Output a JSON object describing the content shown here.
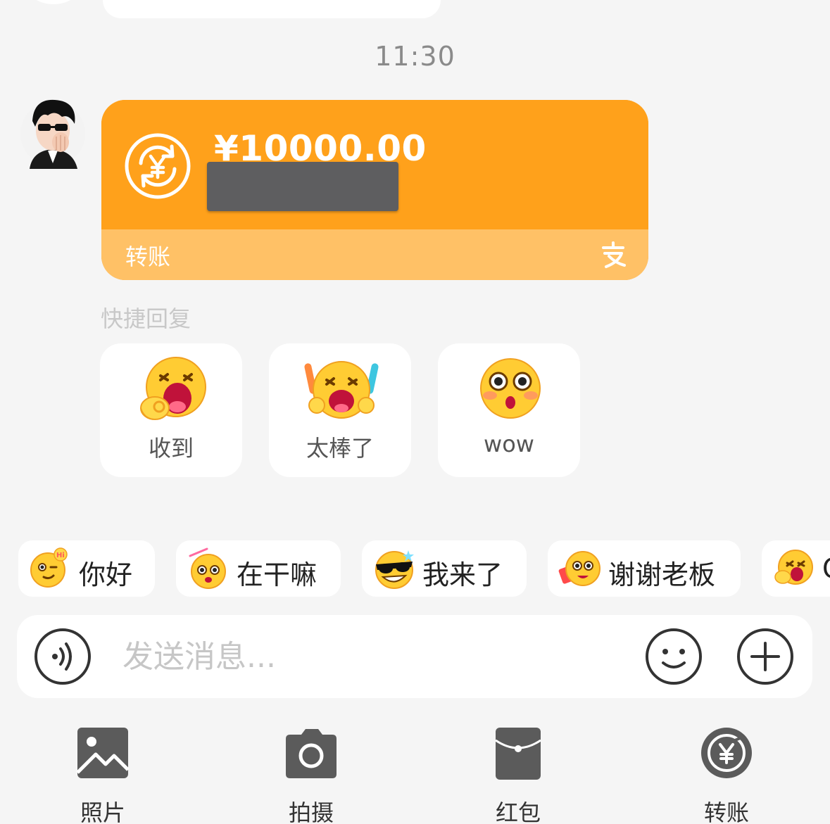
{
  "chat": {
    "timestamp": "11:30"
  },
  "transfer": {
    "amount": "¥10000.00",
    "label": "转账",
    "card_color": "#ffa11b",
    "footer_color": "#ffc166"
  },
  "quick_reply": {
    "title": "快捷回复",
    "items": [
      {
        "label": "收到",
        "icon": "ok-hand-shout-emoji-icon"
      },
      {
        "label": "太棒了",
        "icon": "cheering-emoji-icon"
      },
      {
        "label": "wow",
        "icon": "surprised-emoji-icon"
      }
    ]
  },
  "stickers": [
    {
      "label": "你好",
      "icon": "wink-hi-emoji-icon"
    },
    {
      "label": "在干嘛",
      "icon": "what-doing-emoji-icon"
    },
    {
      "label": "我来了",
      "icon": "sunglasses-emoji-icon"
    },
    {
      "label": "谢谢老板",
      "icon": "thanks-boss-emoji-icon"
    },
    {
      "label": "O",
      "icon": "ok-emoji-icon"
    }
  ],
  "input": {
    "placeholder": "发送消息..."
  },
  "tools": [
    {
      "label": "照片",
      "icon": "photo-icon"
    },
    {
      "label": "拍摄",
      "icon": "camera-icon"
    },
    {
      "label": "红包",
      "icon": "red-packet-icon"
    },
    {
      "label": "转账",
      "icon": "transfer-icon"
    }
  ]
}
